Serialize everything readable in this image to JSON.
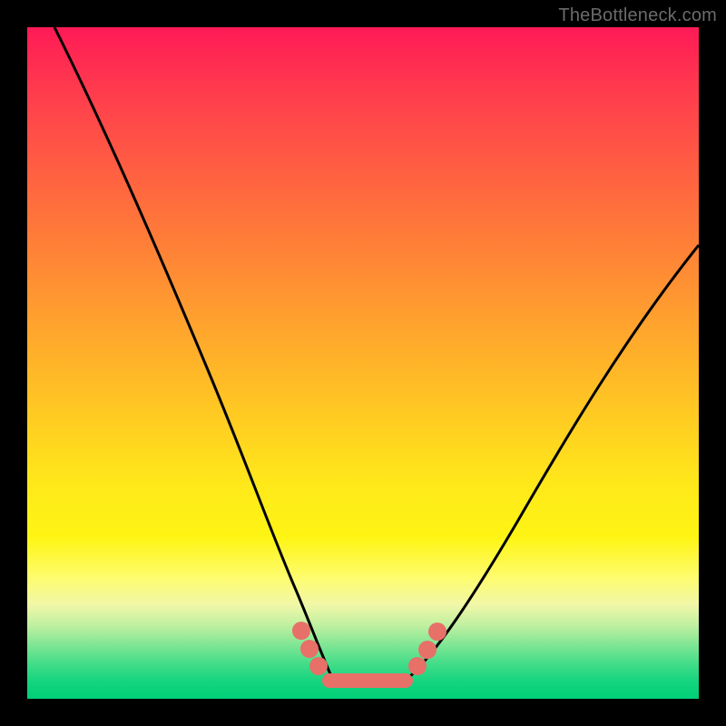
{
  "watermark": "TheBottleneck.com",
  "colors": {
    "frame": "#000000",
    "curve": "#000000",
    "bead": "#e77069",
    "gradient_top": "#ff1a56",
    "gradient_bottom": "#00cf78"
  },
  "chart_data": {
    "type": "line",
    "title": "",
    "xlabel": "",
    "ylabel": "",
    "xlim": [
      0,
      100
    ],
    "ylim": [
      0,
      100
    ],
    "grid": false,
    "legend": false,
    "annotations": [],
    "series": [
      {
        "name": "left-curve",
        "x": [
          4,
          10,
          16,
          22,
          26,
          30,
          34,
          36,
          38,
          40,
          42,
          44
        ],
        "values": [
          100,
          82,
          64,
          46,
          34,
          24,
          15,
          11,
          8,
          5,
          3,
          2
        ]
      },
      {
        "name": "right-curve",
        "x": [
          56,
          60,
          66,
          72,
          78,
          84,
          90,
          96,
          100
        ],
        "values": [
          2,
          4,
          10,
          18,
          27,
          37,
          48,
          59,
          67
        ]
      }
    ],
    "markers": [
      {
        "name": "left-bead-upper",
        "x": 40,
        "y": 11,
        "r": 1.3
      },
      {
        "name": "left-bead-mid",
        "x": 42,
        "y": 8,
        "r": 1.3
      },
      {
        "name": "left-bead-lower",
        "x": 44,
        "y": 5,
        "r": 1.3
      },
      {
        "name": "right-bead-lower",
        "x": 56,
        "y": 5,
        "r": 1.3
      },
      {
        "name": "right-bead-mid",
        "x": 58,
        "y": 8,
        "r": 1.3
      },
      {
        "name": "right-bead-upper",
        "x": 60,
        "y": 11,
        "r": 1.3
      }
    ],
    "valley_bar": {
      "x0": 44,
      "x1": 56,
      "y": 2,
      "thickness": 2.2
    }
  }
}
